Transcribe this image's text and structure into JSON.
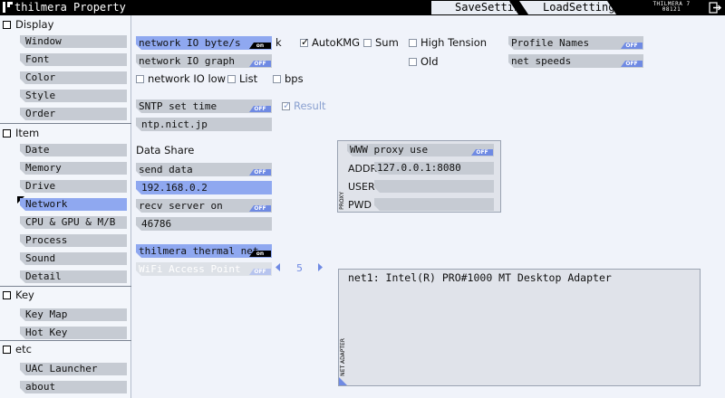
{
  "window": {
    "title": "thilmera Property",
    "brand_line1": "THILMERA 7",
    "brand_line2": "08121"
  },
  "tabs": [
    {
      "label": "SaveSetting"
    },
    {
      "label": "LoadSetting"
    }
  ],
  "sidebar": {
    "sections": [
      {
        "label": "Display",
        "items": [
          "Window",
          "Font",
          "Color",
          "Style",
          "Order"
        ]
      },
      {
        "label": "Item",
        "items": [
          "Date",
          "Memory",
          "Drive",
          "Network",
          "CPU & GPU & M/B",
          "Process",
          "Sound",
          "Detail"
        ]
      },
      {
        "label": "Key",
        "items": [
          "Key Map",
          "Hot Key"
        ]
      },
      {
        "label": "etc",
        "items": [
          "UAC Launcher",
          "about"
        ]
      }
    ],
    "active_item": "Network"
  },
  "network": {
    "io_bytes": {
      "label": "network IO byte/s",
      "state": "on"
    },
    "k_label": "k",
    "autokmg": {
      "label": "AutoKMG",
      "checked": true
    },
    "sum": {
      "label": "Sum",
      "checked": false
    },
    "high_tension": {
      "label": "High Tension",
      "checked": false
    },
    "old": {
      "label": "Old",
      "checked": false
    },
    "io_graph": {
      "label": "network IO graph",
      "state": "OFF"
    },
    "io_low": {
      "label": "network IO low",
      "checked": false
    },
    "list": {
      "label": "List",
      "checked": false
    },
    "bps": {
      "label": "bps",
      "checked": false
    },
    "profile_names": {
      "label": "Profile Names",
      "state": "OFF"
    },
    "net_speeds": {
      "label": "net speeds",
      "state": "OFF"
    }
  },
  "sntp": {
    "label": "SNTP set time",
    "state": "OFF",
    "server": "ntp.nict.jp",
    "result": {
      "label": "Result",
      "checked": true
    }
  },
  "data_share": {
    "heading": "Data Share",
    "send": {
      "label": "send data",
      "state": "OFF"
    },
    "ip": "192.168.0.2",
    "recv": {
      "label": "recv server on",
      "state": "OFF"
    },
    "port": "46786"
  },
  "proxy": {
    "use": {
      "label": "WWW proxy use",
      "state": "OFF"
    },
    "addr_label": "ADDR",
    "addr": "127.0.0.1:8080",
    "user_label": "USER",
    "user": "",
    "pwd_label": "PWD",
    "pwd": "",
    "tag": "PROXY"
  },
  "thermal": {
    "label": "thilmera thermal net",
    "state": "on",
    "wifi": {
      "label": "WiFi Access Point",
      "state": "OFF"
    },
    "index": "5"
  },
  "adapter": {
    "text": "net1: Intel(R) PRO#1000 MT Desktop Adapter",
    "tag": "NET ADAPTER"
  },
  "colors": {
    "accent_blue": "#8fa8f0",
    "switch_blue": "#6f8ae3",
    "item_gray": "#c6cbd3",
    "title_bar": "#000000"
  }
}
